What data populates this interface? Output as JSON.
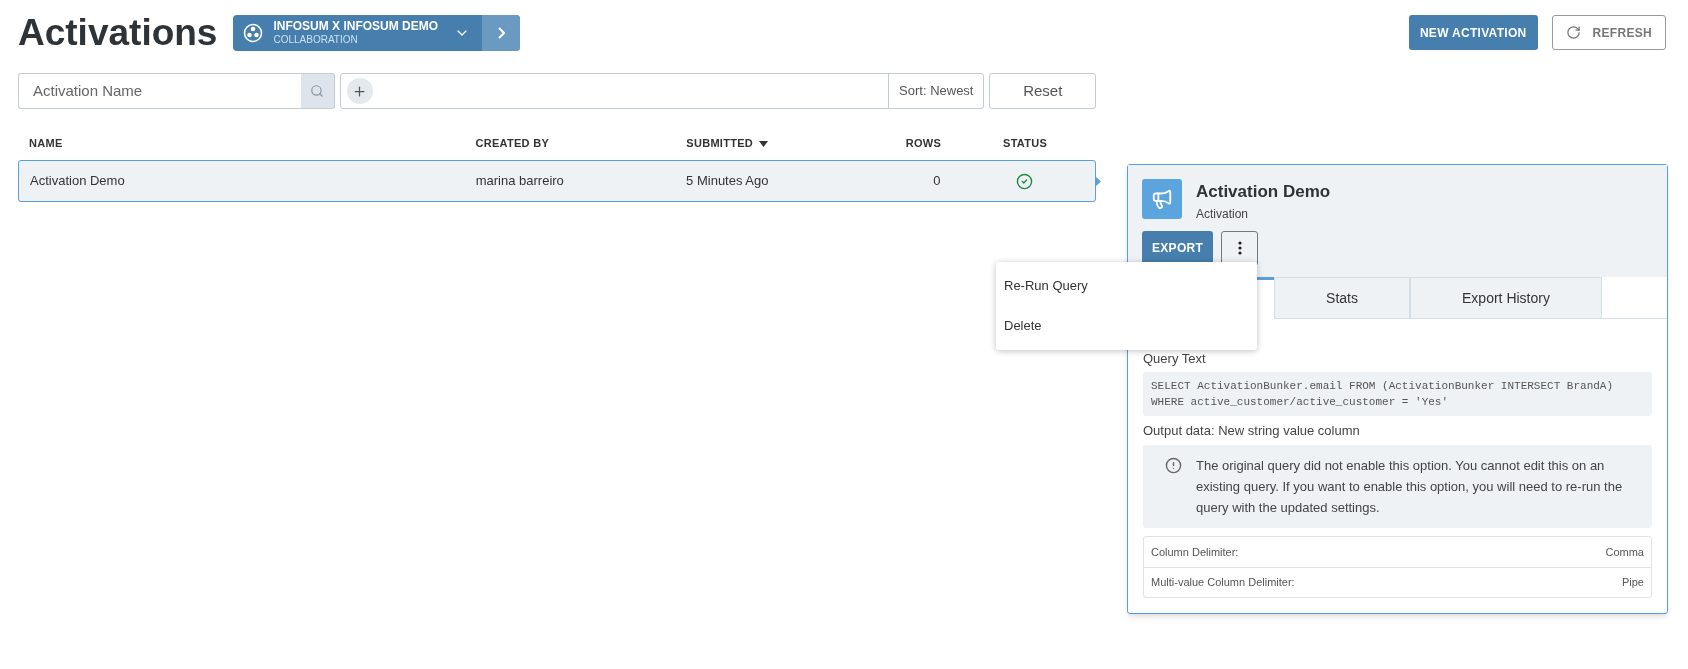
{
  "page_title": "Activations",
  "collaboration": {
    "name": "INFOSUM X INFOSUM DEMO",
    "type": "COLLABORATION"
  },
  "actions": [
    {
      "label": "NEW ACTIVATION",
      "kind": "primary"
    },
    {
      "label": "REFRESH",
      "kind": "refresh"
    }
  ],
  "search": {
    "placeholder": "Activation Name"
  },
  "sort": "Sort: Newest",
  "reset": "Reset",
  "table": {
    "columns": [
      {
        "label": "NAME",
        "sorted": false
      },
      {
        "label": "CREATED BY",
        "sorted": false
      },
      {
        "label": "SUBMITTED",
        "sorted": true
      },
      {
        "label": "ROWS",
        "sorted": false
      },
      {
        "label": "STATUS",
        "sorted": false
      }
    ],
    "rows": [
      {
        "name": "Activation Demo",
        "created_by": "marina barreiro",
        "submitted": "5 Minutes Ago",
        "rows": "0",
        "status_ok": true,
        "selected": true
      }
    ]
  },
  "detail": {
    "title": "Activation Demo",
    "subtitle": "Activation",
    "export": "EXPORT",
    "menu": [
      "Re-Run Query",
      "Delete"
    ],
    "tabs": [
      {
        "selected": true
      },
      {
        "label": "Stats",
        "selected": false
      },
      {
        "label": "Export History",
        "selected": false
      }
    ],
    "query_label": "Query Text",
    "query": "SELECT ActivationBunker.email FROM (ActivationBunker INTERSECT BrandA)\nWHERE active_customer/active_customer = 'Yes'",
    "output_label": "Output data: New string value column",
    "notice": "The original query did not enable this option. You cannot edit this on an existing query. If you want to enable this option, you will need to re-run the query with the updated settings.",
    "settings": [
      {
        "label": "Column Delimiter:",
        "value": "Comma"
      },
      {
        "label": "Multi-value Column Delimiter:",
        "value": "Pipe"
      }
    ]
  }
}
